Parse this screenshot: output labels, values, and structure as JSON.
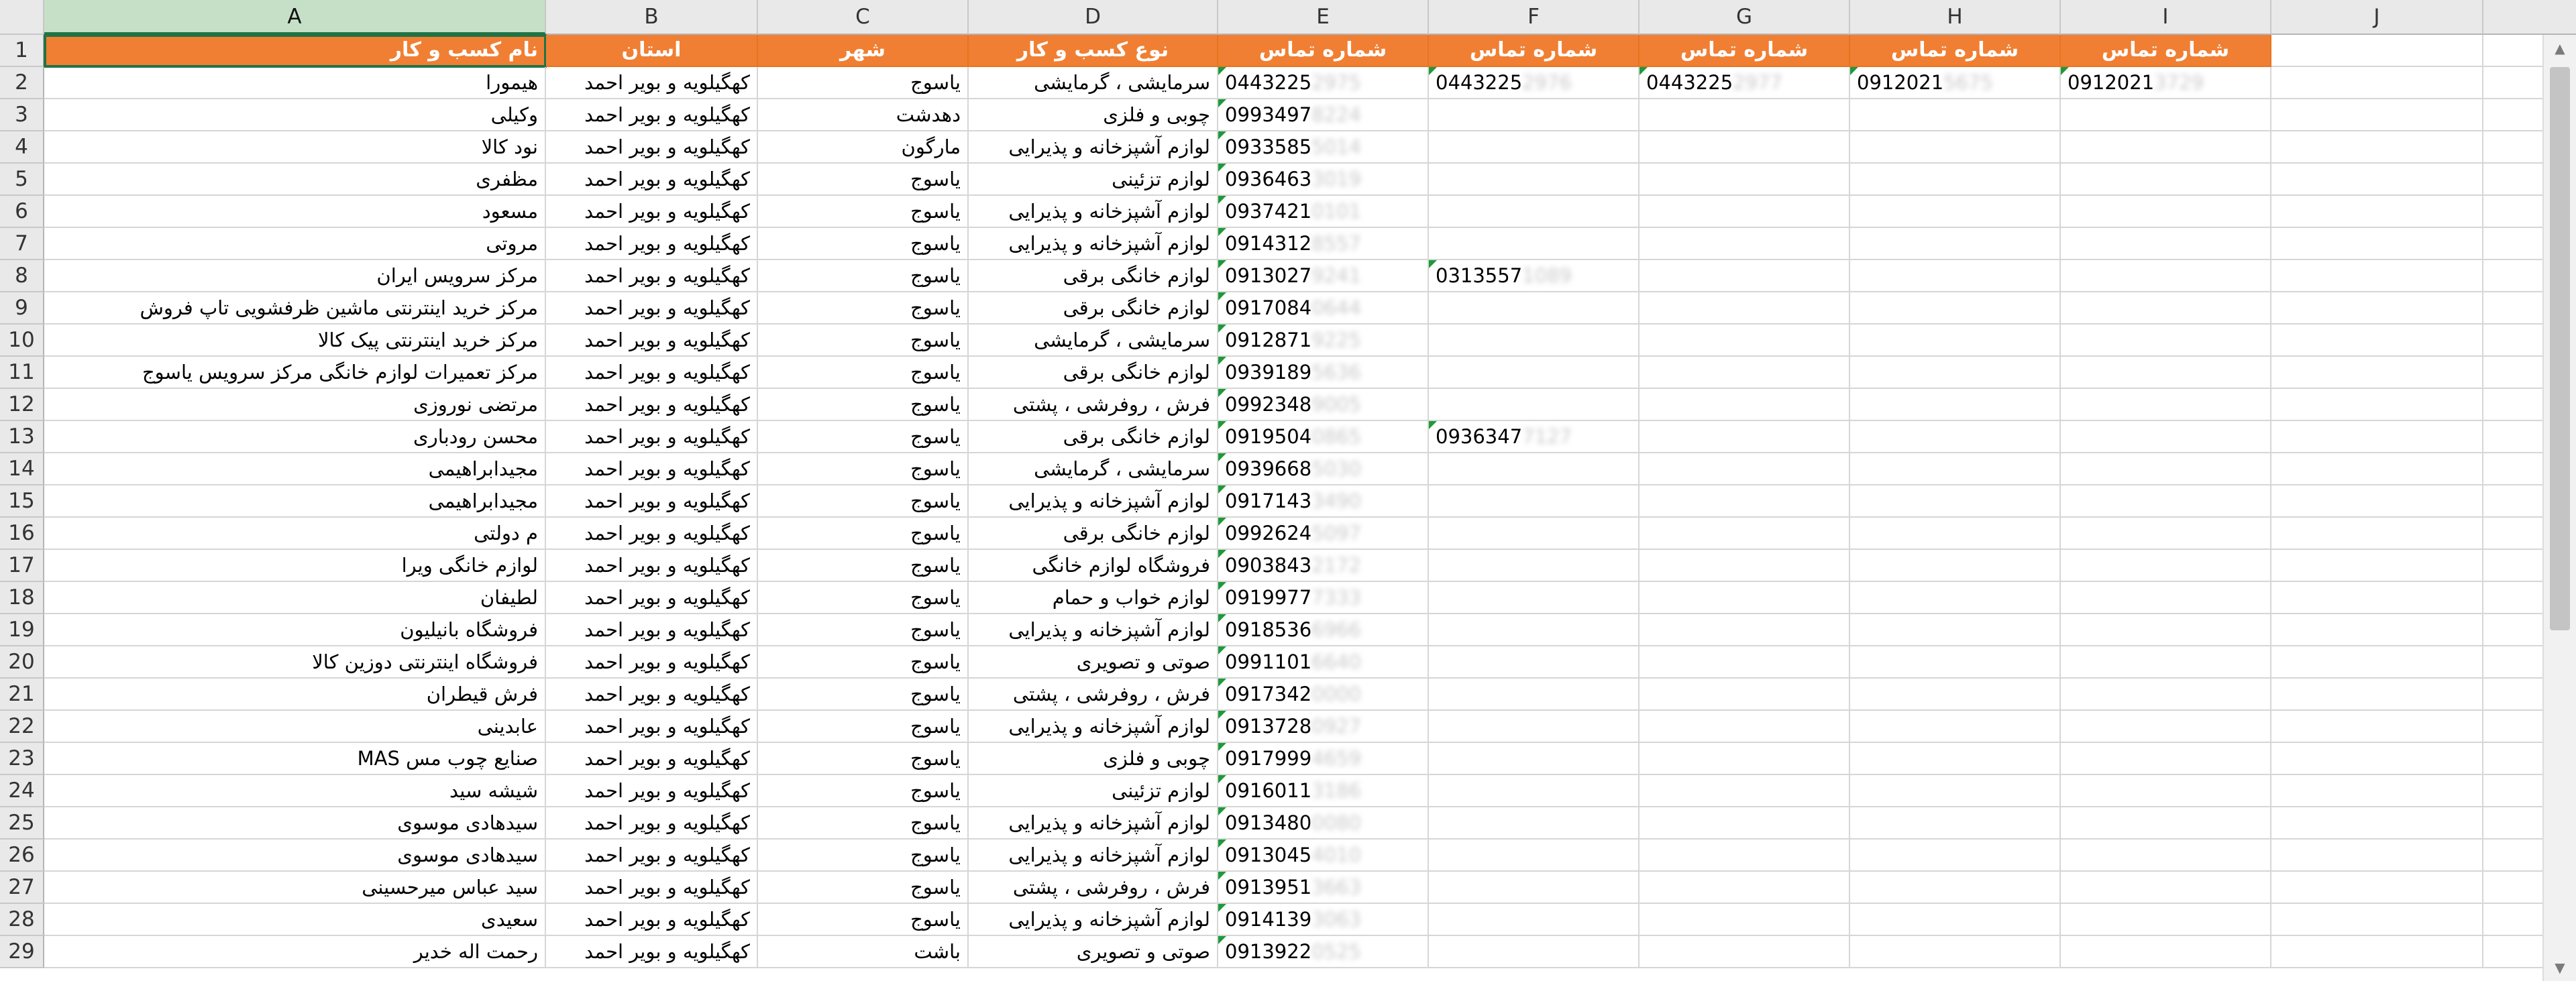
{
  "column_letters": [
    "A",
    "B",
    "C",
    "D",
    "E",
    "F",
    "G",
    "H",
    "I",
    "J"
  ],
  "headers": {
    "A": "نام کسب و کار",
    "B": "استان",
    "C": "شهر",
    "D": "نوع کسب و کار",
    "E": "شماره تماس",
    "F": "شماره تماس",
    "G": "شماره تماس",
    "H": "شماره تماس",
    "I": "شماره تماس"
  },
  "rows": [
    {
      "n": "2",
      "name": "هیمورا",
      "province": "کهگیلویه و بویر احمد",
      "city": "یاسوج",
      "type": "سرمایشی ، گرمایشی",
      "phones": [
        {
          "v": "0443225",
          "b": "2975"
        },
        {
          "v": "0443225",
          "b": "2976"
        },
        {
          "v": "0443225",
          "b": "2977"
        },
        {
          "v": "0912021",
          "b": "5675"
        },
        {
          "v": "0912021",
          "b": "3729"
        }
      ]
    },
    {
      "n": "3",
      "name": "وکیلی",
      "province": "کهگیلویه و بویر احمد",
      "city": "دهدشت",
      "type": "چوبی و فلزی",
      "phones": [
        {
          "v": "0993497",
          "b": "8224"
        }
      ]
    },
    {
      "n": "4",
      "name": "نود کالا",
      "province": "کهگیلویه و بویر احمد",
      "city": "مارگون",
      "type": "لوازم آشپزخانه و پذیرایی",
      "phones": [
        {
          "v": "0933585",
          "b": "5014"
        }
      ]
    },
    {
      "n": "5",
      "name": "مظفری",
      "province": "کهگیلویه و بویر احمد",
      "city": "یاسوج",
      "type": "لوازم تزئینی",
      "phones": [
        {
          "v": "0936463",
          "b": "3019"
        }
      ]
    },
    {
      "n": "6",
      "name": "مسعود",
      "province": "کهگیلویه و بویر احمد",
      "city": "یاسوج",
      "type": "لوازم آشپزخانه و پذیرایی",
      "phones": [
        {
          "v": "0937421",
          "b": "0101"
        }
      ]
    },
    {
      "n": "7",
      "name": "مروتی",
      "province": "کهگیلویه و بویر احمد",
      "city": "یاسوج",
      "type": "لوازم آشپزخانه و پذیرایی",
      "phones": [
        {
          "v": "0914312",
          "b": "8557"
        }
      ]
    },
    {
      "n": "8",
      "name": "مرکز سرویس ایران",
      "province": "کهگیلویه و بویر احمد",
      "city": "یاسوج",
      "type": "لوازم خانگی برقی",
      "phones": [
        {
          "v": "0913027",
          "b": "9241"
        },
        {
          "v": "0313557",
          "b": "1089"
        }
      ]
    },
    {
      "n": "9",
      "name": "مرکز خرید اینترنتی ماشین ظرفشویی تاپ فروش",
      "province": "کهگیلویه و بویر احمد",
      "city": "یاسوج",
      "type": "لوازم خانگی برقی",
      "phones": [
        {
          "v": "0917084",
          "b": "0644"
        }
      ]
    },
    {
      "n": "10",
      "name": "مرکز خرید اینترنتی پیک کالا",
      "province": "کهگیلویه و بویر احمد",
      "city": "یاسوج",
      "type": "سرمایشی ، گرمایشی",
      "phones": [
        {
          "v": "0912871",
          "b": "9225"
        }
      ]
    },
    {
      "n": "11",
      "name": "مرکز تعمیرات لوازم خانگی  مرکز سرویس یاسوج",
      "province": "کهگیلویه و بویر احمد",
      "city": "یاسوج",
      "type": "لوازم خانگی برقی",
      "phones": [
        {
          "v": "0939189",
          "b": "5636"
        }
      ]
    },
    {
      "n": "12",
      "name": "مرتضی نوروزی",
      "province": "کهگیلویه و بویر احمد",
      "city": "یاسوج",
      "type": "فرش ، روفرشی ، پشتی",
      "phones": [
        {
          "v": "0992348",
          "b": "9005"
        }
      ]
    },
    {
      "n": "13",
      "name": "محسن رودباری",
      "province": "کهگیلویه و بویر احمد",
      "city": "یاسوج",
      "type": "لوازم خانگی برقی",
      "phones": [
        {
          "v": "0919504",
          "b": "0865"
        },
        {
          "v": "0936347",
          "b": "7127"
        }
      ]
    },
    {
      "n": "14",
      "name": "مجیدابراهیمی",
      "province": "کهگیلویه و بویر احمد",
      "city": "یاسوج",
      "type": "سرمایشی ، گرمایشی",
      "phones": [
        {
          "v": "0939668",
          "b": "5030"
        }
      ]
    },
    {
      "n": "15",
      "name": "مجیدابراهیمی",
      "province": "کهگیلویه و بویر احمد",
      "city": "یاسوج",
      "type": "لوازم آشپزخانه و پذیرایی",
      "phones": [
        {
          "v": "0917143",
          "b": "3490"
        }
      ]
    },
    {
      "n": "16",
      "name": "م دولتی",
      "province": "کهگیلویه و بویر احمد",
      "city": "یاسوج",
      "type": "لوازم خانگی برقی",
      "phones": [
        {
          "v": "0992624",
          "b": "5097"
        }
      ]
    },
    {
      "n": "17",
      "name": "لوازم خانگی ویرا",
      "province": "کهگیلویه و بویر احمد",
      "city": "یاسوج",
      "type": "فروشگاه لوازم خانگی",
      "phones": [
        {
          "v": "0903843",
          "b": "2172"
        }
      ]
    },
    {
      "n": "18",
      "name": "لطیفان",
      "province": "کهگیلویه و بویر احمد",
      "city": "یاسوج",
      "type": "لوازم خواب و حمام",
      "phones": [
        {
          "v": "0919977",
          "b": "7333"
        }
      ]
    },
    {
      "n": "19",
      "name": "فروشگاه بانیلیون",
      "province": "کهگیلویه و بویر احمد",
      "city": "یاسوج",
      "type": "لوازم آشپزخانه و پذیرایی",
      "phones": [
        {
          "v": "0918536",
          "b": "6966"
        }
      ]
    },
    {
      "n": "20",
      "name": "فروشگاه اینترنتی دوزین کالا",
      "province": "کهگیلویه و بویر احمد",
      "city": "یاسوج",
      "type": "صوتی و تصویری",
      "phones": [
        {
          "v": "0991101",
          "b": "6640"
        }
      ]
    },
    {
      "n": "21",
      "name": "فرش قیطران",
      "province": "کهگیلویه و بویر احمد",
      "city": "یاسوج",
      "type": "فرش ، روفرشی ، پشتی",
      "phones": [
        {
          "v": "0917342",
          "b": "0000"
        }
      ]
    },
    {
      "n": "22",
      "name": "عابدینی",
      "province": "کهگیلویه و بویر احمد",
      "city": "یاسوج",
      "type": "لوازم آشپزخانه و پذیرایی",
      "phones": [
        {
          "v": "0913728",
          "b": "0927"
        }
      ]
    },
    {
      "n": "23",
      "name": "صنایع چوب مس MAS",
      "province": "کهگیلویه و بویر احمد",
      "city": "یاسوج",
      "type": "چوبی و فلزی",
      "phones": [
        {
          "v": "0917999",
          "b": "4659"
        }
      ]
    },
    {
      "n": "24",
      "name": "شیشه سید",
      "province": "کهگیلویه و بویر احمد",
      "city": "یاسوج",
      "type": "لوازم تزئینی",
      "phones": [
        {
          "v": "0916011",
          "b": "3186"
        }
      ]
    },
    {
      "n": "25",
      "name": "سیدهادی موسوی",
      "province": "کهگیلویه و بویر احمد",
      "city": "یاسوج",
      "type": "لوازم آشپزخانه و پذیرایی",
      "phones": [
        {
          "v": "0913480",
          "b": "0080"
        }
      ]
    },
    {
      "n": "26",
      "name": "سیدهادی موسوی",
      "province": "کهگیلویه و بویر احمد",
      "city": "یاسوج",
      "type": "لوازم آشپزخانه و پذیرایی",
      "phones": [
        {
          "v": "0913045",
          "b": "4010"
        }
      ]
    },
    {
      "n": "27",
      "name": "سید عباس میرحسینی",
      "province": "کهگیلویه و بویر احمد",
      "city": "یاسوج",
      "type": "فرش ، روفرشی ، پشتی",
      "phones": [
        {
          "v": "0913951",
          "b": "3663"
        }
      ]
    },
    {
      "n": "28",
      "name": "سعیدی",
      "province": "کهگیلویه و بویر احمد",
      "city": "یاسوج",
      "type": "لوازم آشپزخانه و پذیرایی",
      "phones": [
        {
          "v": "0914139",
          "b": "3063"
        }
      ]
    },
    {
      "n": "29",
      "name": "رحمت اله خدیر",
      "province": "کهگیلویه و بویر احمد",
      "city": "باشت",
      "type": "صوتی و تصویری",
      "phones": [
        {
          "v": "0913922",
          "b": "0525"
        }
      ]
    }
  ],
  "colors": {
    "header_fill": "#f07f33",
    "header_text": "#ffffff",
    "selected_column": "#c6e0c8",
    "comment_marker": "#1e9a3a"
  },
  "icons": {
    "scroll_up": "▲",
    "scroll_down": "▼"
  }
}
